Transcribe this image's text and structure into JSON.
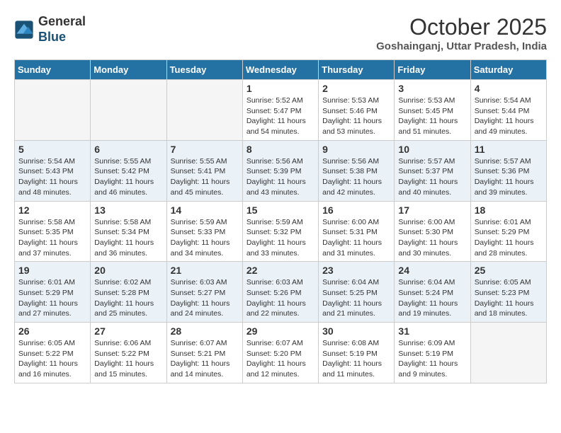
{
  "header": {
    "logo_line1": "General",
    "logo_line2": "Blue",
    "title": "October 2025",
    "subtitle": "Goshainganj, Uttar Pradesh, India"
  },
  "days_of_week": [
    "Sunday",
    "Monday",
    "Tuesday",
    "Wednesday",
    "Thursday",
    "Friday",
    "Saturday"
  ],
  "weeks": [
    [
      {
        "day": "",
        "info": ""
      },
      {
        "day": "",
        "info": ""
      },
      {
        "day": "",
        "info": ""
      },
      {
        "day": "1",
        "info": "Sunrise: 5:52 AM\nSunset: 5:47 PM\nDaylight: 11 hours\nand 54 minutes."
      },
      {
        "day": "2",
        "info": "Sunrise: 5:53 AM\nSunset: 5:46 PM\nDaylight: 11 hours\nand 53 minutes."
      },
      {
        "day": "3",
        "info": "Sunrise: 5:53 AM\nSunset: 5:45 PM\nDaylight: 11 hours\nand 51 minutes."
      },
      {
        "day": "4",
        "info": "Sunrise: 5:54 AM\nSunset: 5:44 PM\nDaylight: 11 hours\nand 49 minutes."
      }
    ],
    [
      {
        "day": "5",
        "info": "Sunrise: 5:54 AM\nSunset: 5:43 PM\nDaylight: 11 hours\nand 48 minutes."
      },
      {
        "day": "6",
        "info": "Sunrise: 5:55 AM\nSunset: 5:42 PM\nDaylight: 11 hours\nand 46 minutes."
      },
      {
        "day": "7",
        "info": "Sunrise: 5:55 AM\nSunset: 5:41 PM\nDaylight: 11 hours\nand 45 minutes."
      },
      {
        "day": "8",
        "info": "Sunrise: 5:56 AM\nSunset: 5:39 PM\nDaylight: 11 hours\nand 43 minutes."
      },
      {
        "day": "9",
        "info": "Sunrise: 5:56 AM\nSunset: 5:38 PM\nDaylight: 11 hours\nand 42 minutes."
      },
      {
        "day": "10",
        "info": "Sunrise: 5:57 AM\nSunset: 5:37 PM\nDaylight: 11 hours\nand 40 minutes."
      },
      {
        "day": "11",
        "info": "Sunrise: 5:57 AM\nSunset: 5:36 PM\nDaylight: 11 hours\nand 39 minutes."
      }
    ],
    [
      {
        "day": "12",
        "info": "Sunrise: 5:58 AM\nSunset: 5:35 PM\nDaylight: 11 hours\nand 37 minutes."
      },
      {
        "day": "13",
        "info": "Sunrise: 5:58 AM\nSunset: 5:34 PM\nDaylight: 11 hours\nand 36 minutes."
      },
      {
        "day": "14",
        "info": "Sunrise: 5:59 AM\nSunset: 5:33 PM\nDaylight: 11 hours\nand 34 minutes."
      },
      {
        "day": "15",
        "info": "Sunrise: 5:59 AM\nSunset: 5:32 PM\nDaylight: 11 hours\nand 33 minutes."
      },
      {
        "day": "16",
        "info": "Sunrise: 6:00 AM\nSunset: 5:31 PM\nDaylight: 11 hours\nand 31 minutes."
      },
      {
        "day": "17",
        "info": "Sunrise: 6:00 AM\nSunset: 5:30 PM\nDaylight: 11 hours\nand 30 minutes."
      },
      {
        "day": "18",
        "info": "Sunrise: 6:01 AM\nSunset: 5:29 PM\nDaylight: 11 hours\nand 28 minutes."
      }
    ],
    [
      {
        "day": "19",
        "info": "Sunrise: 6:01 AM\nSunset: 5:29 PM\nDaylight: 11 hours\nand 27 minutes."
      },
      {
        "day": "20",
        "info": "Sunrise: 6:02 AM\nSunset: 5:28 PM\nDaylight: 11 hours\nand 25 minutes."
      },
      {
        "day": "21",
        "info": "Sunrise: 6:03 AM\nSunset: 5:27 PM\nDaylight: 11 hours\nand 24 minutes."
      },
      {
        "day": "22",
        "info": "Sunrise: 6:03 AM\nSunset: 5:26 PM\nDaylight: 11 hours\nand 22 minutes."
      },
      {
        "day": "23",
        "info": "Sunrise: 6:04 AM\nSunset: 5:25 PM\nDaylight: 11 hours\nand 21 minutes."
      },
      {
        "day": "24",
        "info": "Sunrise: 6:04 AM\nSunset: 5:24 PM\nDaylight: 11 hours\nand 19 minutes."
      },
      {
        "day": "25",
        "info": "Sunrise: 6:05 AM\nSunset: 5:23 PM\nDaylight: 11 hours\nand 18 minutes."
      }
    ],
    [
      {
        "day": "26",
        "info": "Sunrise: 6:05 AM\nSunset: 5:22 PM\nDaylight: 11 hours\nand 16 minutes."
      },
      {
        "day": "27",
        "info": "Sunrise: 6:06 AM\nSunset: 5:22 PM\nDaylight: 11 hours\nand 15 minutes."
      },
      {
        "day": "28",
        "info": "Sunrise: 6:07 AM\nSunset: 5:21 PM\nDaylight: 11 hours\nand 14 minutes."
      },
      {
        "day": "29",
        "info": "Sunrise: 6:07 AM\nSunset: 5:20 PM\nDaylight: 11 hours\nand 12 minutes."
      },
      {
        "day": "30",
        "info": "Sunrise: 6:08 AM\nSunset: 5:19 PM\nDaylight: 11 hours\nand 11 minutes."
      },
      {
        "day": "31",
        "info": "Sunrise: 6:09 AM\nSunset: 5:19 PM\nDaylight: 11 hours\nand 9 minutes."
      },
      {
        "day": "",
        "info": ""
      }
    ]
  ]
}
